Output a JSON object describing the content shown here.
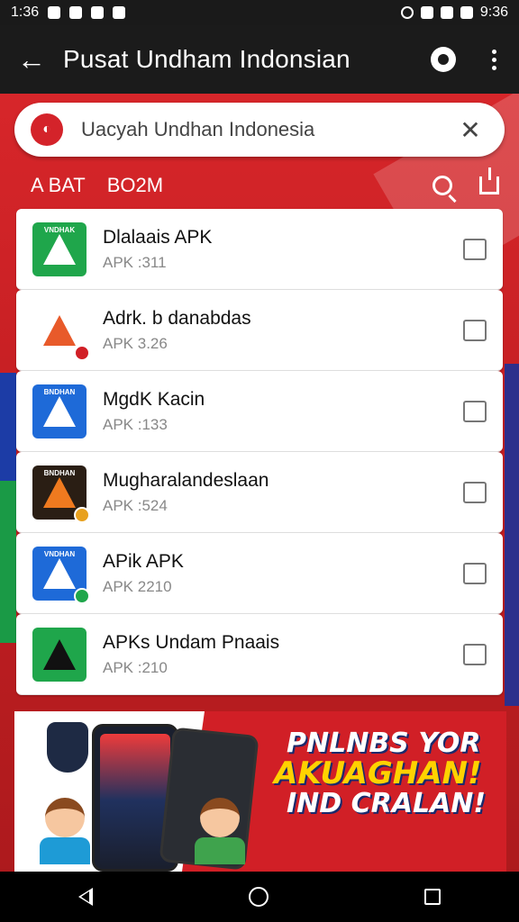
{
  "status_bar": {
    "time": "1:36",
    "right_time": "9:36"
  },
  "app_bar": {
    "title": "Pusat Undham Indonsian"
  },
  "search": {
    "text": "Uacyah Undhan Indonesia"
  },
  "filters": {
    "a": "A BAT",
    "b": "BO2M"
  },
  "list": [
    {
      "title": "Dlalaais APK",
      "sub": "APK :311",
      "icon_color": "#1fa64b",
      "icon_text": "VNDHAK"
    },
    {
      "title": "Adrk. b danabdas",
      "sub": "APK 3.26",
      "icon_color": "#ffffff",
      "icon_text": ""
    },
    {
      "title": "MgdK Kacin",
      "sub": "APK :133",
      "icon_color": "#1e6ad8",
      "icon_text": "BNDHAN"
    },
    {
      "title": "Mugharalandeslaan",
      "sub": "APK :524",
      "icon_color": "#2a1e14",
      "icon_text": "BNDHAN"
    },
    {
      "title": "APik APK",
      "sub": "APK 2210",
      "icon_color": "#1e6ad8",
      "icon_text": "VNDHAN"
    },
    {
      "title": "APKs Undam Pnaais",
      "sub": "APK :210",
      "icon_color": "#1fa64b",
      "icon_text": ""
    }
  ],
  "banner": {
    "line1": "PNLNBS YOR",
    "line2": "AKUAGHAN!",
    "line3": "IND CRALAN!"
  },
  "colors": {
    "brand_red": "#d11f26",
    "accent_yellow": "#ffd200"
  }
}
